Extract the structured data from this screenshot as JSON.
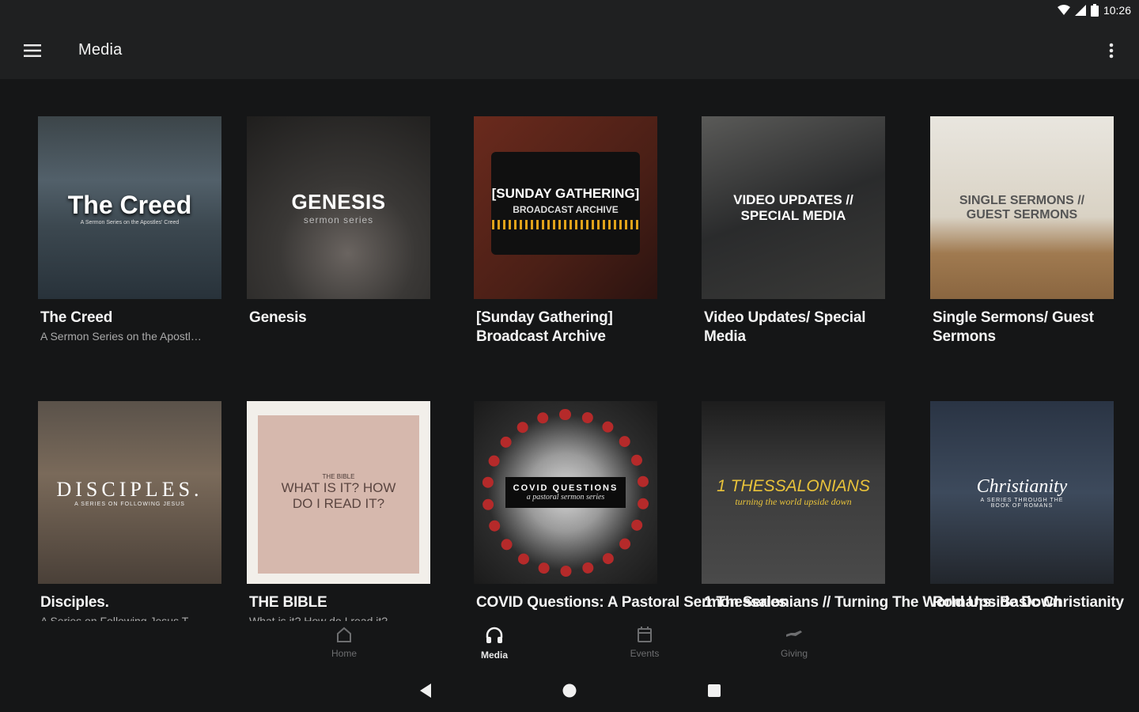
{
  "status": {
    "time": "10:26"
  },
  "appbar": {
    "title": "Media"
  },
  "cards": [
    {
      "title": "The Creed",
      "subtitle": "A Sermon Series on the Apostl…",
      "thumb_text": "The Creed",
      "thumb_sub": "A Sermon Series on the Apostles' Creed"
    },
    {
      "title": "Genesis",
      "subtitle": "",
      "thumb_text": "GENESIS",
      "thumb_sub": "sermon series"
    },
    {
      "title": "[Sunday Gathering] Broadcast Archive",
      "subtitle": "",
      "thumb_text": "[SUNDAY GATHERING]",
      "thumb_sub": "BROADCAST ARCHIVE"
    },
    {
      "title": "Video Updates/ Special Media",
      "subtitle": "",
      "thumb_text": "VIDEO UPDATES //",
      "thumb_sub": "SPECIAL MEDIA"
    },
    {
      "title": "Single Sermons/ Guest Sermons",
      "subtitle": "",
      "thumb_text": "SINGLE SERMONS //",
      "thumb_sub": "GUEST SERMONS"
    },
    {
      "title": "Disciples.",
      "subtitle": "A Series on Following Jesus T…",
      "thumb_text": "DISCIPLES.",
      "thumb_sub": "A SERIES ON FOLLOWING JESUS"
    },
    {
      "title": "THE BIBLE",
      "subtitle": "What is it? How do I read it?",
      "thumb_text": "WHAT IS IT? HOW DO I READ IT?",
      "thumb_sub": "THE BIBLE"
    },
    {
      "title": "COVID Questions: A Pastoral Sermon Series",
      "subtitle": "",
      "thumb_text": "COVID QUESTIONS",
      "thumb_sub": "a pastoral sermon series"
    },
    {
      "title": "1 Thessalonians // Turning The World Upside Down",
      "subtitle": "",
      "thumb_text": "1 THESSALONIANS",
      "thumb_sub": "turning the world upside down"
    },
    {
      "title": "Romans: Basic Christianity",
      "subtitle": "",
      "thumb_text": "Christianity",
      "thumb_sub": "A SERIES THROUGH THE BOOK OF ROMANS"
    }
  ],
  "bottomnav": {
    "items": [
      {
        "label": "Home",
        "icon": "home-icon"
      },
      {
        "label": "Media",
        "icon": "headphones-icon"
      },
      {
        "label": "Events",
        "icon": "calendar-icon"
      },
      {
        "label": "Giving",
        "icon": "giving-icon"
      }
    ],
    "active": "Media"
  },
  "colors": {
    "background": "#151617",
    "appbar": "#1f2021",
    "inactive": "#6d6e70"
  }
}
